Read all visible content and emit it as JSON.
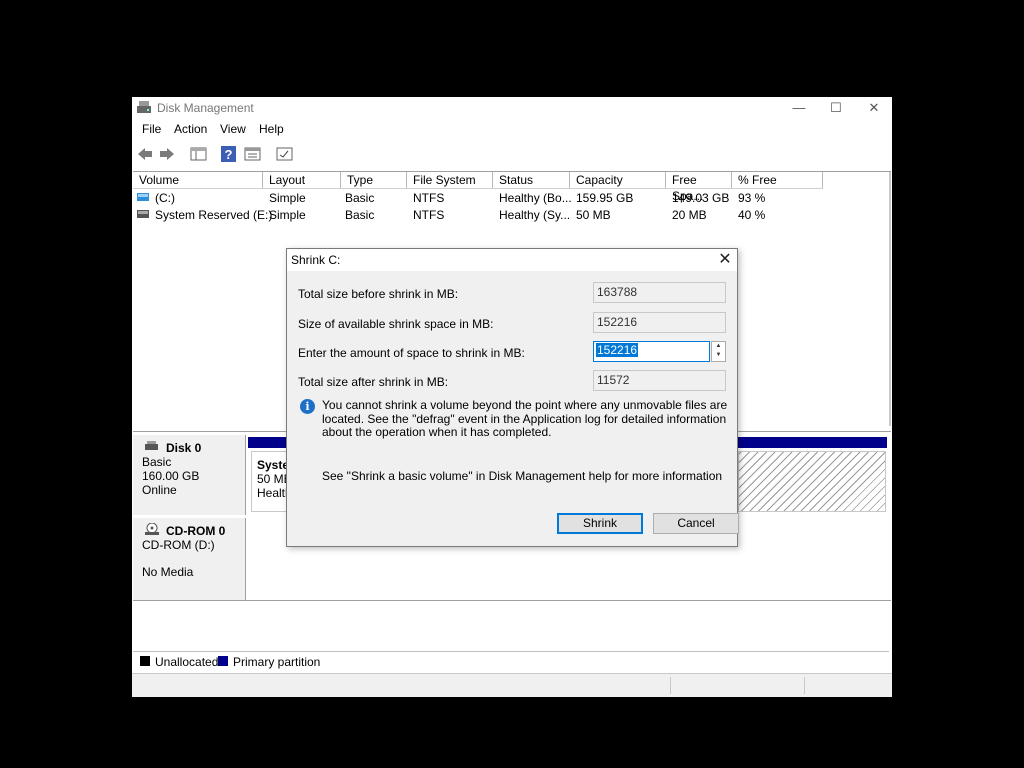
{
  "window": {
    "title": "Disk Management",
    "controls": {
      "minimize": "—",
      "maximize": "☐",
      "close": "✕"
    }
  },
  "menu": [
    "File",
    "Action",
    "View",
    "Help"
  ],
  "volumes": {
    "columns": [
      "Volume",
      "Layout",
      "Type",
      "File System",
      "Status",
      "Capacity",
      "Free Spa...",
      "% Free"
    ],
    "rows": [
      [
        "(C:)",
        "Simple",
        "Basic",
        "NTFS",
        "Healthy (Bo...",
        "159.95 GB",
        "149.03 GB",
        "93 %"
      ],
      [
        "System Reserved (E:)",
        "Simple",
        "Basic",
        "NTFS",
        "Healthy (Sy...",
        "50 MB",
        "20 MB",
        "40 %"
      ]
    ]
  },
  "disks": {
    "disk0": {
      "name": "Disk 0",
      "type": "Basic",
      "size": "160.00 GB",
      "status": "Online",
      "partition": {
        "name": "Syster",
        "size": "50 MB",
        "status": "Healthy"
      }
    },
    "cdrom0": {
      "name": "CD-ROM 0",
      "type": "CD-ROM (D:)",
      "status": "No Media"
    }
  },
  "legend": {
    "unallocated": "Unallocated",
    "primary": "Primary partition",
    "unallocated_color": "#000000",
    "primary_color": "#00008b"
  },
  "dialog": {
    "title": "Shrink C:",
    "close": "✕",
    "total_before_label": "Total size before shrink in MB:",
    "total_before_value": "163788",
    "available_label": "Size of available shrink space in MB:",
    "available_value": "152216",
    "amount_label": "Enter the amount of space to shrink in MB:",
    "amount_value": "152216",
    "total_after_label": "Total size after shrink in MB:",
    "total_after_value": "11572",
    "info_text": "You cannot shrink a volume beyond the point where any unmovable files are located. See the \"defrag\" event in the Application log for detailed information about the operation when it has completed.",
    "help_text": "See \"Shrink a basic volume\" in Disk Management help for more information",
    "shrink_label": "Shrink",
    "cancel_label": "Cancel"
  }
}
